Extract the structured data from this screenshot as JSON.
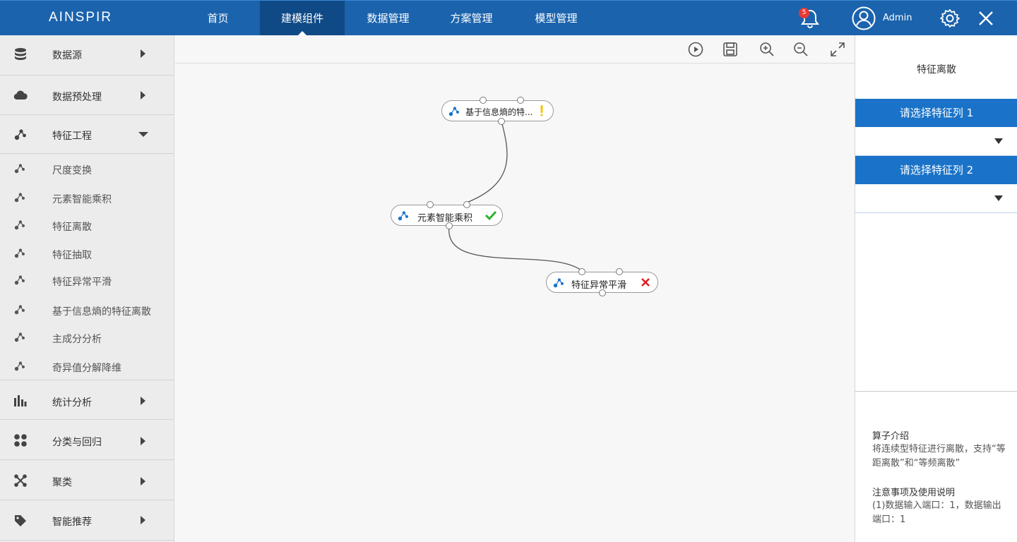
{
  "brand": "AINSPIR",
  "nav": [
    "首页",
    "建模组件",
    "数据管理",
    "方案管理",
    "模型管理"
  ],
  "notifications": {
    "count": "5"
  },
  "user": {
    "name": "Admin"
  },
  "sidebar": {
    "categories": [
      {
        "label": "数据源",
        "icon": "database-icon"
      },
      {
        "label": "数据预处理",
        "icon": "cloud-icon"
      },
      {
        "label": "特征工程",
        "icon": "feature-icon",
        "expanded": true
      },
      {
        "label": "统计分析",
        "icon": "bar-chart-icon"
      },
      {
        "label": "分类与回归",
        "icon": "grid-dots-icon"
      },
      {
        "label": "聚类",
        "icon": "cluster-icon"
      },
      {
        "label": "智能推荐",
        "icon": "tag-icon"
      }
    ],
    "feature_items": [
      "尺度变换",
      "元素智能乘积",
      "特征离散",
      "特征抽取",
      "特征异常平滑",
      "基于信息熵的特征离散",
      "主成分分析",
      "奇异值分解降维"
    ]
  },
  "toolbar": {
    "icons": [
      "run-icon",
      "save-icon",
      "zoom-in-icon",
      "zoom-out-icon",
      "fullscreen-icon"
    ]
  },
  "nodes": [
    {
      "label": "基于信息熵的特...",
      "status": "warning"
    },
    {
      "label": "元素智能乘积",
      "status": "success"
    },
    {
      "label": "特征异常平滑",
      "status": "error"
    }
  ],
  "right_panel": {
    "title": "特征离散",
    "select1_label": "请选择特征列 1",
    "select2_label": "请选择特征列 2",
    "intro_heading": "算子介绍",
    "intro_text": "将连续型特征进行离散，支持“等距离散”和“等频离散”",
    "notes_heading": "注意事项及使用说明",
    "notes_text": "(1)数据输入端口：1，数据输出端口：1"
  },
  "colors": {
    "topbar": "#1b63ad",
    "active_nav": "#0f4a86",
    "accent": "#1a73c8",
    "warning": "#f5c400",
    "success": "#2cb52c",
    "error": "#e02020"
  }
}
